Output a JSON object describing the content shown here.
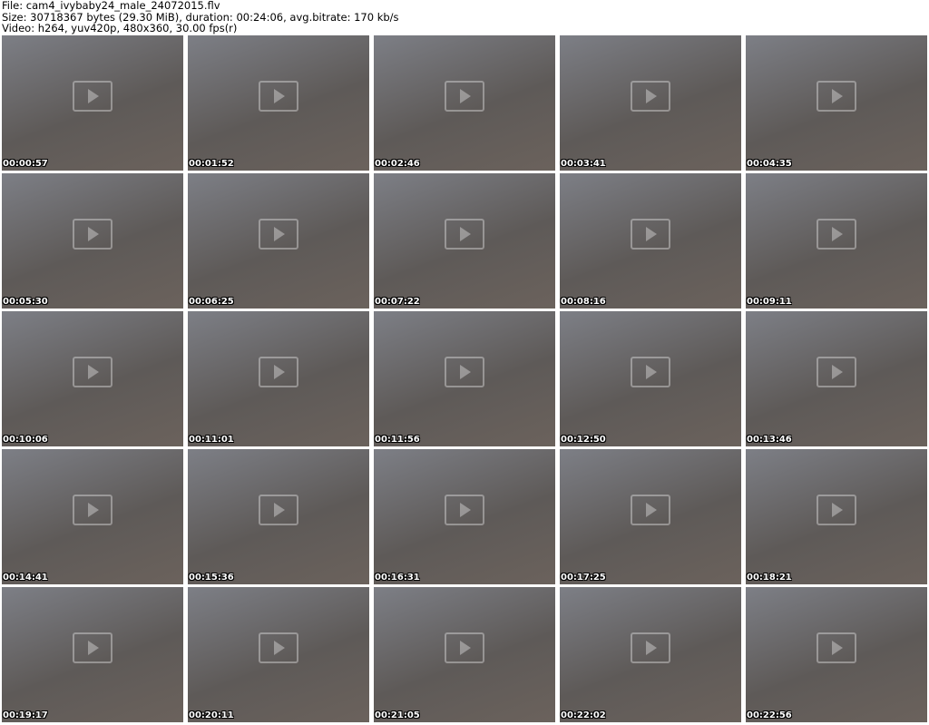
{
  "header": {
    "file_line": "File: cam4_ivybaby24_male_24072015.flv",
    "size_line": "Size: 30718367 bytes (29.30 MiB), duration: 00:24:06, avg.bitrate: 170 kb/s",
    "video_line": "Video: h264, yuv420p, 480x360, 30.00 fps(r)"
  },
  "thumbnails": [
    "00:00:57",
    "00:01:52",
    "00:02:46",
    "00:03:41",
    "00:04:35",
    "00:05:30",
    "00:06:25",
    "00:07:22",
    "00:08:16",
    "00:09:11",
    "00:10:06",
    "00:11:01",
    "00:11:56",
    "00:12:50",
    "00:13:46",
    "00:14:41",
    "00:15:36",
    "00:16:31",
    "00:17:25",
    "00:18:21",
    "00:19:17",
    "00:20:11",
    "00:21:05",
    "00:22:02",
    "00:22:56"
  ]
}
